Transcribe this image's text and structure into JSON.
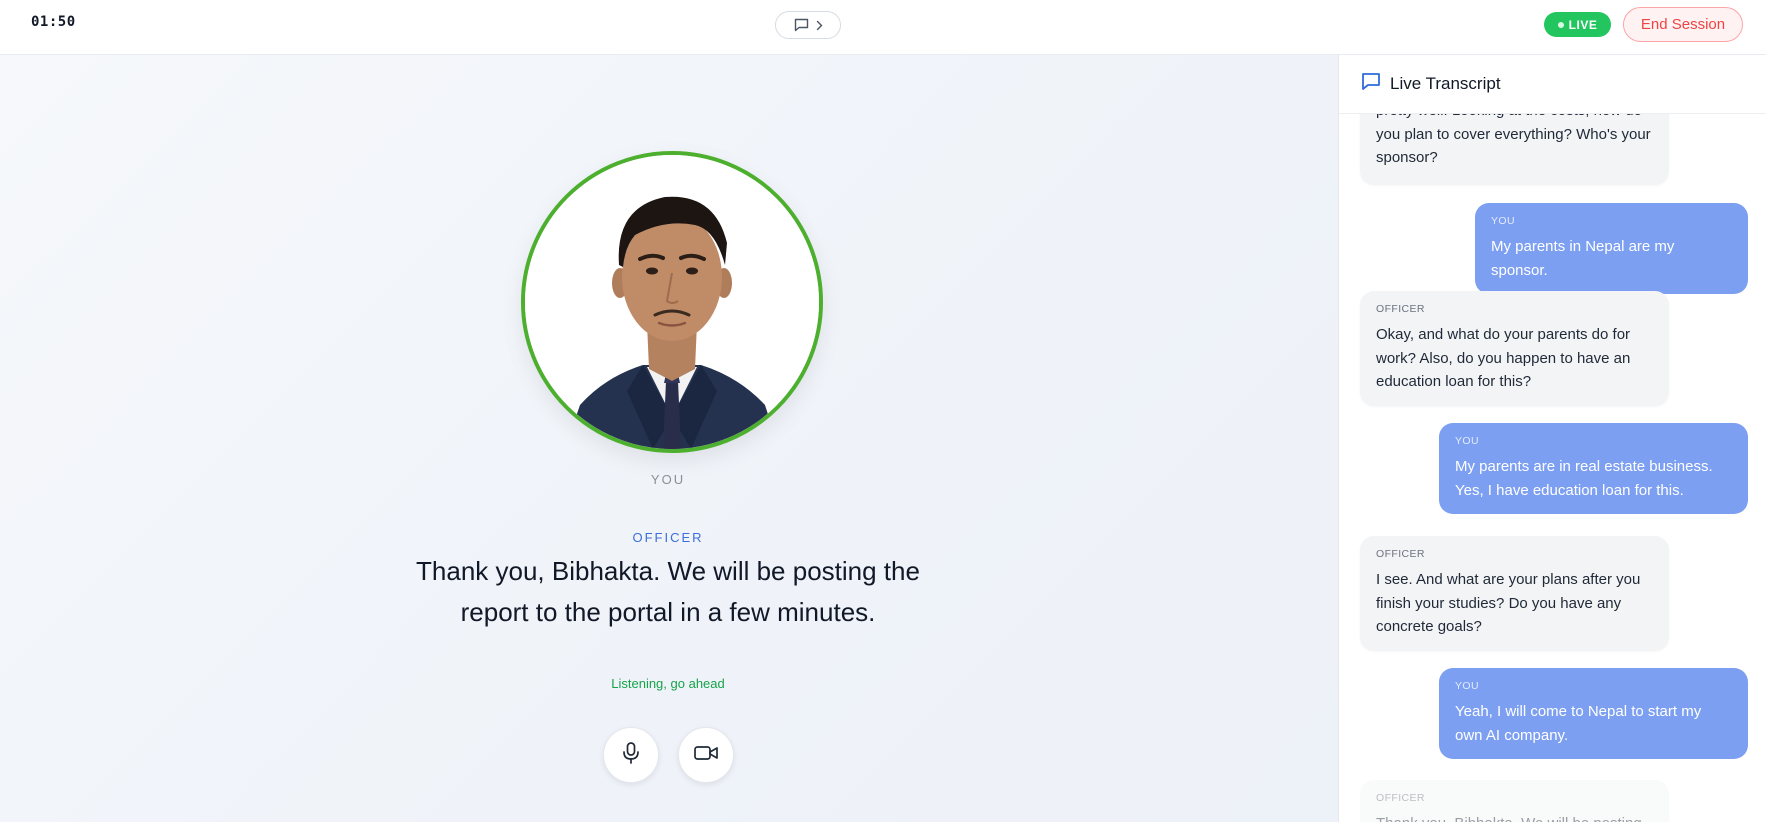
{
  "topbar": {
    "timer": "01:50",
    "live_label": "LIVE",
    "end_session_label": "End Session",
    "live_color": "#22c55e"
  },
  "stage": {
    "you_label": "YOU",
    "officer_label": "OFFICER",
    "officer_speech": "Thank you, Bibhakta. We will be posting the report to the portal in a few minutes.",
    "status": "Listening, go ahead",
    "avatar_ring_color": "#4caf2e"
  },
  "transcript": {
    "title": "Live Transcript",
    "messages": [
      {
        "speaker": "",
        "text": "pretty well. Looking at the costs, how do you plan to cover everything? Who's your sponsor?"
      },
      {
        "speaker": "YOU",
        "text": "My parents in Nepal are my sponsor."
      },
      {
        "speaker": "OFFICER",
        "text": "Okay, and what do your parents do for work? Also, do you happen to have an education loan for this?"
      },
      {
        "speaker": "YOU",
        "text": "My parents are in real estate business. Yes, I have education loan for this."
      },
      {
        "speaker": "OFFICER",
        "text": "I see. And what are your plans after you finish your studies? Do you have any concrete goals?"
      },
      {
        "speaker": "YOU",
        "text": "Yeah, I will come to Nepal to start my own AI company."
      },
      {
        "speaker": "OFFICER",
        "text": "Thank you, Bibhakta. We will be posting"
      }
    ]
  }
}
